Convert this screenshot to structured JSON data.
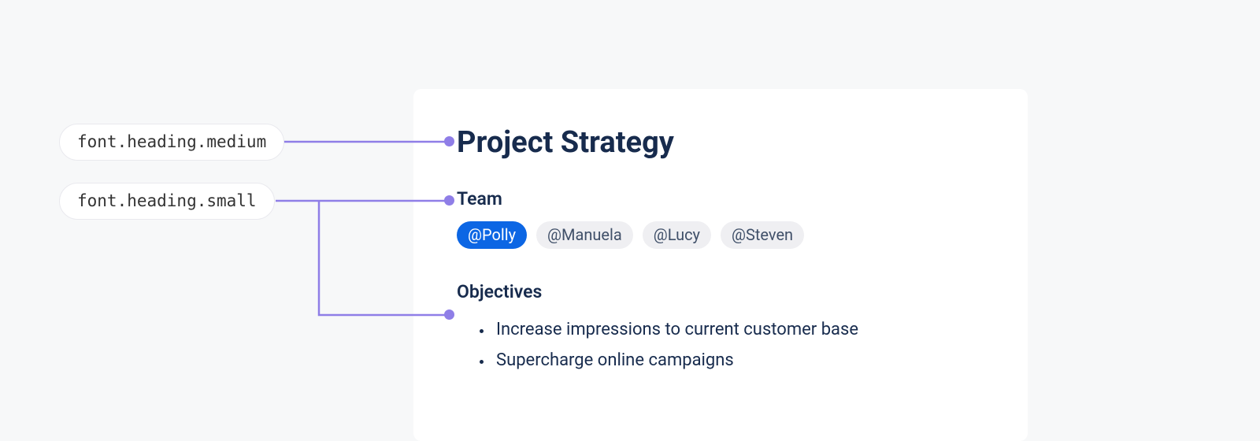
{
  "annotations": {
    "medium": "font.heading.medium",
    "small": "font.heading.small"
  },
  "card": {
    "title": "Project Strategy",
    "team": {
      "heading": "Team",
      "tags": {
        "primary": "@Polly",
        "t1": "@Manuela",
        "t2": "@Lucy",
        "t3": "@Steven"
      }
    },
    "objectives": {
      "heading": "Objectives",
      "items": {
        "i0": "Increase impressions to current customer base",
        "i1": "Supercharge online campaigns"
      }
    }
  },
  "colors": {
    "connector": "#8F7EE7",
    "tag_primary_bg": "#0C66E4",
    "tag_default_bg": "#EFEFF2",
    "heading_text": "#172B4D"
  }
}
